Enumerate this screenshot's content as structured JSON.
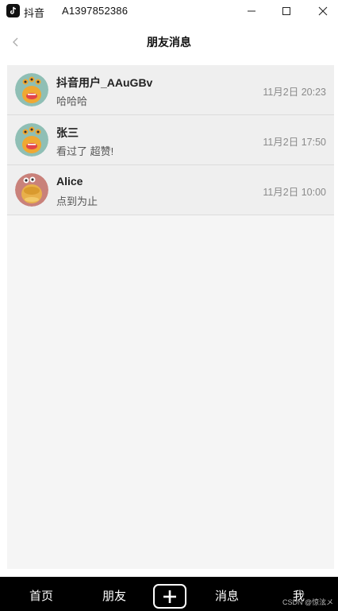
{
  "titlebar": {
    "app_name": "抖音",
    "account_id": "A1397852386"
  },
  "header": {
    "title": "朋友消息"
  },
  "conversations": [
    {
      "name": "抖音用户_AAuGBv",
      "preview": "哈哈哈",
      "time": "11月2日 20:23",
      "avatar": "green-monster-avatar"
    },
    {
      "name": "张三",
      "preview": "看过了 超赞!",
      "time": "11月2日 17:50",
      "avatar": "green-monster-avatar"
    },
    {
      "name": "Alice",
      "preview": "点到为止",
      "time": "11月2日 10:00",
      "avatar": "pink-monster-avatar"
    }
  ],
  "bottom_nav": {
    "home": "首页",
    "friends": "朋友",
    "messages": "消息",
    "me": "我"
  },
  "watermark": "CSDN @惊泫メ",
  "colors": {
    "nav_background": "#000000",
    "panel_background": "#f5f5f5",
    "row_background": "#efefef"
  }
}
